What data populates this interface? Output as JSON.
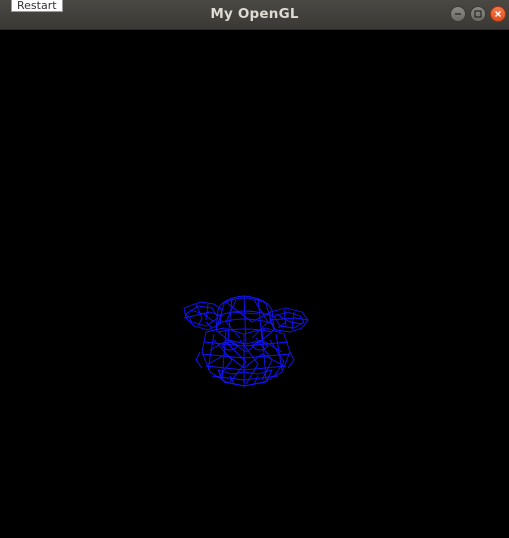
{
  "window": {
    "title": "My OpenGL"
  },
  "tooltip": {
    "label": "Restart"
  },
  "window_controls": {
    "minimize_icon": "minimize-icon",
    "maximize_icon": "maximize-icon",
    "close_icon": "close-icon"
  },
  "viewport": {
    "background": "#000000",
    "wireframe_color": "#1010ff"
  }
}
